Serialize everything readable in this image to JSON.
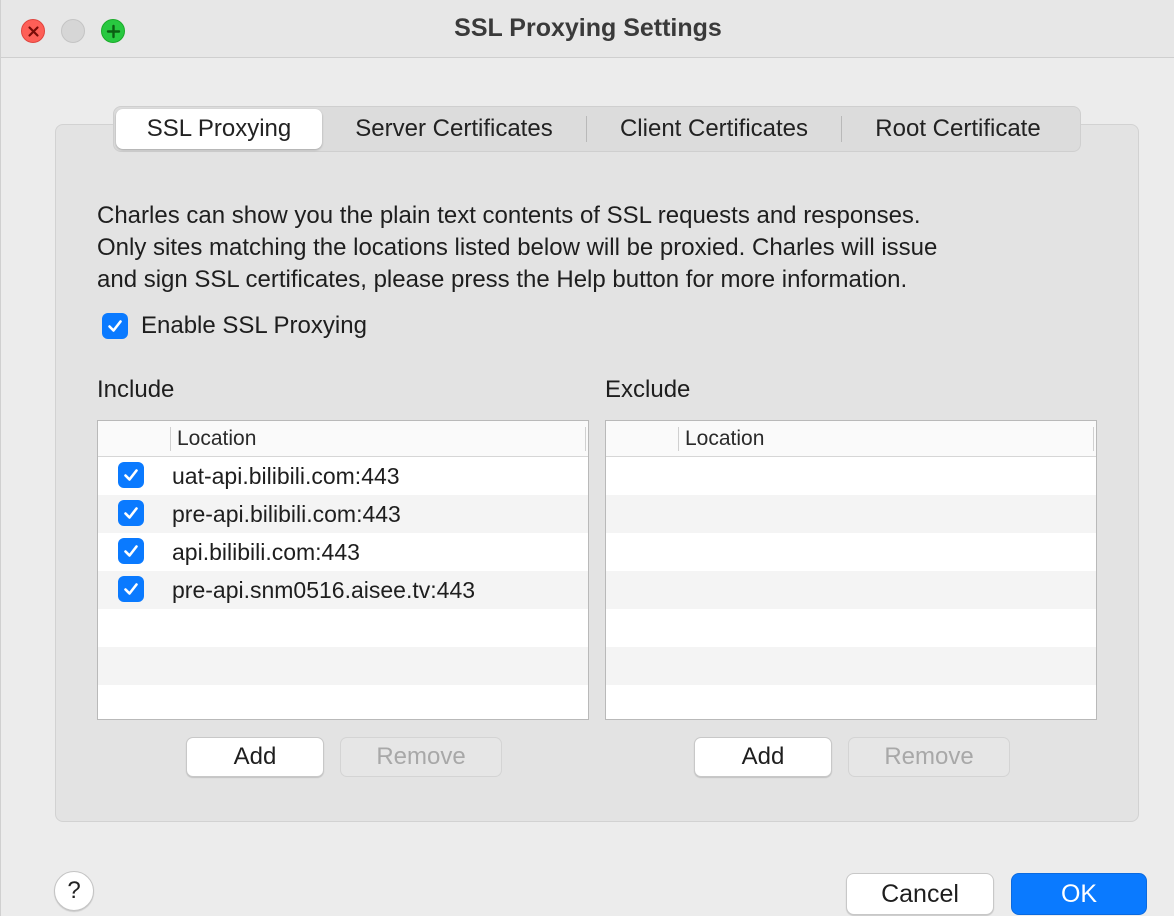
{
  "window": {
    "title": "SSL Proxying Settings"
  },
  "tabs": [
    {
      "label": "SSL Proxying",
      "active": true
    },
    {
      "label": "Server Certificates",
      "active": false
    },
    {
      "label": "Client Certificates",
      "active": false
    },
    {
      "label": "Root Certificate",
      "active": false
    }
  ],
  "description": {
    "line1": "Charles can show you the plain text contents of SSL requests and responses.",
    "line2": "Only sites matching the locations listed below will be proxied. Charles will issue",
    "line3": "and sign SSL certificates, please press the Help button for more information."
  },
  "enable_ssl": {
    "label": "Enable SSL Proxying",
    "checked": true
  },
  "include": {
    "label": "Include",
    "column_header": "Location",
    "rows": [
      {
        "location": "uat-api.bilibili.com:443",
        "enabled": true
      },
      {
        "location": "pre-api.bilibili.com:443",
        "enabled": true
      },
      {
        "location": "api.bilibili.com:443",
        "enabled": true
      },
      {
        "location": "pre-api.snm0516.aisee.tv:443",
        "enabled": true
      }
    ],
    "add_label": "Add",
    "remove_label": "Remove"
  },
  "exclude": {
    "label": "Exclude",
    "column_header": "Location",
    "rows": [],
    "add_label": "Add",
    "remove_label": "Remove"
  },
  "footer": {
    "help_label": "?",
    "cancel_label": "Cancel",
    "ok_label": "OK"
  },
  "colors": {
    "accent": "#0a7aff",
    "close": "#fe5f57",
    "zoom": "#28c840"
  }
}
